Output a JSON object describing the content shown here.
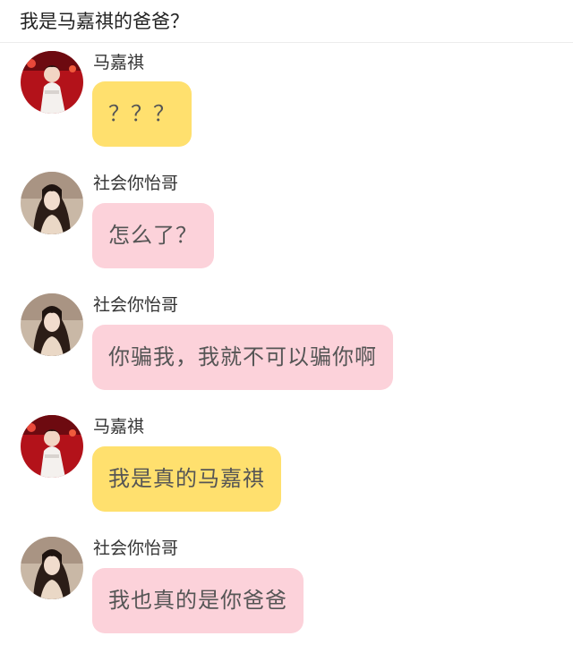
{
  "page_title": "我是马嘉祺的爸爸？",
  "colors": {
    "yellow_bubble": "#ffe06e",
    "pink_bubble": "#fcd2da",
    "text": "#555555"
  },
  "messages": [
    {
      "sender": "马嘉祺",
      "text": "？？？",
      "bubble_color": "yellow",
      "avatar": "red-stage-avatar"
    },
    {
      "sender": "社会你怡哥",
      "text": "怎么了？",
      "bubble_color": "pink",
      "avatar": "long-hair-girl-avatar"
    },
    {
      "sender": "社会你怡哥",
      "text": "你骗我，我就不可以骗你啊",
      "bubble_color": "pink",
      "avatar": "long-hair-girl-avatar"
    },
    {
      "sender": "马嘉祺",
      "text": "我是真的马嘉祺",
      "bubble_color": "yellow",
      "avatar": "red-stage-avatar"
    },
    {
      "sender": "社会你怡哥",
      "text": "我也真的是你爸爸",
      "bubble_color": "pink",
      "avatar": "long-hair-girl-avatar"
    }
  ]
}
